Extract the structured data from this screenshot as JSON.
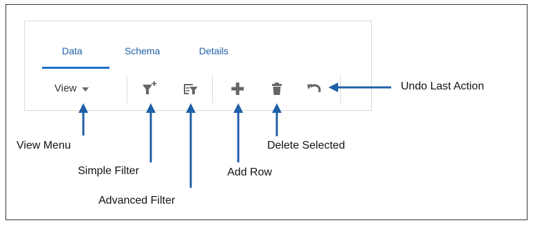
{
  "tabs": [
    {
      "label": "Data",
      "active": true
    },
    {
      "label": "Schema",
      "active": false
    },
    {
      "label": "Details",
      "active": false
    }
  ],
  "toolbar": {
    "view_label": "View",
    "icons": [
      "funnel-plus-icon",
      "funnel-list-icon",
      "plus-icon",
      "trash-icon",
      "undo-icon"
    ]
  },
  "callouts": {
    "view_menu": "View Menu",
    "simple_filter": "Simple Filter",
    "advanced_filter": "Advanced Filter",
    "add_row": "Add Row",
    "delete_selected": "Delete Selected",
    "undo_last_action": "Undo Last Action"
  },
  "colors": {
    "tab_text": "#1f5fa8",
    "tab_underline": "#1f6fc5",
    "arrow": "#1f5fa8",
    "icon": "#666666"
  }
}
